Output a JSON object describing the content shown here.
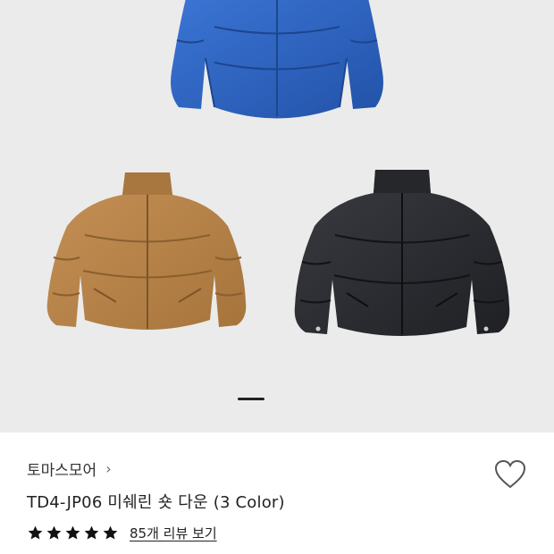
{
  "gallery": {
    "image_count_indicator": "carousel",
    "active_index": 0,
    "items": [
      {
        "color_name": "blue",
        "color": "#2f67c9"
      },
      {
        "color_name": "camel",
        "color": "#b8844a"
      },
      {
        "color_name": "black",
        "color": "#2b2d31"
      }
    ]
  },
  "product": {
    "brand": "토마스모어",
    "brand_chevron": "›",
    "title": "TD4-JP06 미쉐린 숏 다운 (3 Color)",
    "rating_value": 5,
    "rating_max": 5,
    "review_link": "85개 리뷰 보기",
    "wishlist_icon": "heart-outline-icon"
  },
  "colors": {
    "star": "#111111",
    "heart_stroke": "#555555",
    "indicator": "#222222"
  }
}
